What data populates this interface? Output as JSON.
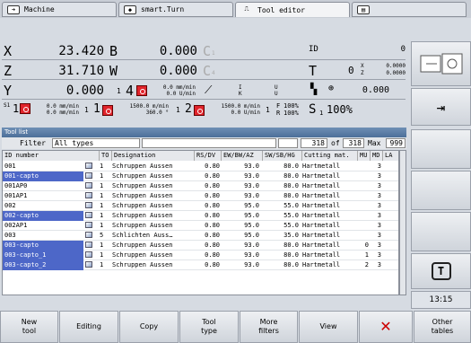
{
  "tabs": [
    {
      "label": "Machine"
    },
    {
      "label": "smart.Turn"
    },
    {
      "label": "Tool editor"
    },
    {
      "label": ""
    }
  ],
  "pos": {
    "x_label": "X",
    "x_value": "23.420",
    "b_label": "B",
    "b_value": "0.000",
    "c1_label": "C",
    "c1_sub": "1",
    "id_label": "ID",
    "id_value": "0",
    "z_label": "Z",
    "z_value": "31.710",
    "w_label": "W",
    "w_value": "0.000",
    "c4_label": "C",
    "c4_sub": "4",
    "t_label": "T",
    "t_value": "0",
    "x_off_label": "X",
    "x_off": "0.0000",
    "z_off_label": "Z",
    "z_off": "0.0000",
    "y_label": "Y",
    "y_value": "0.000",
    "ch1": "1",
    "ch4": "4",
    "f4_a": "0.0 mm/min",
    "f4_b": "0.0 U/min",
    "ik_i": "I",
    "ik_k": "K",
    "ik_u1": "U",
    "ik_u2": "U",
    "dist_value": "0.000"
  },
  "status": {
    "s1_top": "S1",
    "s1_num": "1",
    "feed1_a": "0.0 mm/min",
    "feed1_b": "0.0 mm/min",
    "n1": "1",
    "m1": "1",
    "sp1_a": "1500.0 m/min",
    "sp1_b": "360.0 °",
    "n2": "1",
    "m2": "2",
    "sp2_a": "1500.0 m/min",
    "sp2_b": "0.0 U/min",
    "n3": "1",
    "f_label": "F",
    "f_pct": "100%",
    "r_label": "R",
    "r_pct": "100%",
    "s_label": "S",
    "s_num": "1",
    "s_pct": "100%"
  },
  "list": {
    "title": "Tool list",
    "filter_label": "Filter",
    "filter_value": "All types",
    "count": "318",
    "of_label": "of",
    "total": "318",
    "max_label": "Max",
    "max_value": "999"
  },
  "columns": [
    "ID number",
    "TO",
    "Designation",
    "RS/DV",
    "EW/BW/AZ",
    "SW/SB/HG",
    "Cutting mat.",
    "MU",
    "MD",
    "LA"
  ],
  "rows": [
    {
      "id": "001",
      "to": "1",
      "des": "Schruppen Aussen",
      "rs": "0.80",
      "ew": "93.0",
      "sw": "80.0",
      "mat": "Hartmetall",
      "mu": "",
      "md": "3",
      "la": "",
      "sel": false
    },
    {
      "id": "001-capto",
      "to": "1",
      "des": "Schruppen Aussen",
      "rs": "0.80",
      "ew": "93.0",
      "sw": "80.0",
      "mat": "Hartmetall",
      "mu": "",
      "md": "3",
      "la": "",
      "sel": true
    },
    {
      "id": "001AP0",
      "to": "1",
      "des": "Schruppen Aussen",
      "rs": "0.80",
      "ew": "93.0",
      "sw": "80.0",
      "mat": "Hartmetall",
      "mu": "",
      "md": "3",
      "la": "",
      "sel": false
    },
    {
      "id": "001AP1",
      "to": "1",
      "des": "Schruppen Aussen",
      "rs": "0.80",
      "ew": "93.0",
      "sw": "80.0",
      "mat": "Hartmetall",
      "mu": "",
      "md": "3",
      "la": "",
      "sel": false
    },
    {
      "id": "002",
      "to": "1",
      "des": "Schruppen Aussen",
      "rs": "0.80",
      "ew": "95.0",
      "sw": "55.0",
      "mat": "Hartmetall",
      "mu": "",
      "md": "3",
      "la": "",
      "sel": false
    },
    {
      "id": "002-capto",
      "to": "1",
      "des": "Schruppen Aussen",
      "rs": "0.80",
      "ew": "95.0",
      "sw": "55.0",
      "mat": "Hartmetall",
      "mu": "",
      "md": "3",
      "la": "",
      "sel": true
    },
    {
      "id": "002AP1",
      "to": "1",
      "des": "Schruppen Aussen",
      "rs": "0.80",
      "ew": "95.0",
      "sw": "55.0",
      "mat": "Hartmetall",
      "mu": "",
      "md": "3",
      "la": "",
      "sel": false
    },
    {
      "id": "003",
      "to": "5",
      "des": "Schlichten Auss…",
      "rs": "0.80",
      "ew": "95.0",
      "sw": "35.0",
      "mat": "Hartmetall",
      "mu": "",
      "md": "3",
      "la": "",
      "sel": false
    },
    {
      "id": "003-capto",
      "to": "1",
      "des": "Schruppen Aussen",
      "rs": "0.80",
      "ew": "93.0",
      "sw": "80.0",
      "mat": "Hartmetall",
      "mu": "0",
      "md": "3",
      "la": "",
      "sel": true
    },
    {
      "id": "003-capto_1",
      "to": "1",
      "des": "Schruppen Aussen",
      "rs": "0.80",
      "ew": "93.0",
      "sw": "80.0",
      "mat": "Hartmetall",
      "mu": "1",
      "md": "3",
      "la": "",
      "sel": true
    },
    {
      "id": "003-capto_2",
      "to": "1",
      "des": "Schruppen Aussen",
      "rs": "0.80",
      "ew": "93.0",
      "sw": "80.0",
      "mat": "Hartmetall",
      "mu": "2",
      "md": "3",
      "la": "",
      "sel": true
    }
  ],
  "clock": "13:15",
  "softkeys": [
    "New\ntool",
    "Editing",
    "Copy",
    "Tool\ntype",
    "More\nfilters",
    "View",
    "",
    "Other\ntables"
  ],
  "colors": {
    "accent": "#4d67c8",
    "header": "#5a7aa5",
    "red": "#e0242b"
  }
}
